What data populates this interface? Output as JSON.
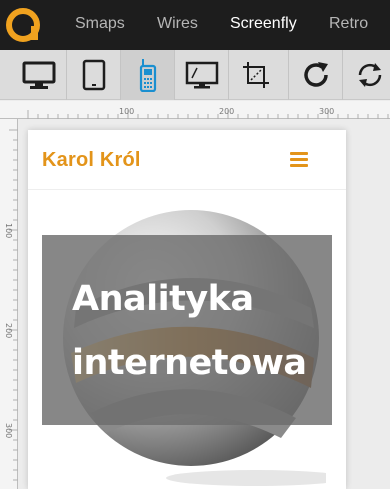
{
  "topbar": {
    "nav": [
      {
        "label": "Smaps"
      },
      {
        "label": "Wires"
      },
      {
        "label": "Screenfly"
      },
      {
        "label": "Retro"
      }
    ],
    "active_index": 2
  },
  "toolbar": {
    "tools": [
      {
        "icon": "desktop-icon"
      },
      {
        "icon": "tablet-icon"
      },
      {
        "icon": "mobile-phone-icon"
      },
      {
        "icon": "television-icon"
      },
      {
        "icon": "custom-size-icon"
      },
      {
        "icon": "refresh-icon"
      },
      {
        "icon": "rotate-icon"
      }
    ],
    "active_index": 2
  },
  "rulers": {
    "top_labels": [
      "100",
      "200",
      "300"
    ],
    "left_labels": [
      "100",
      "200",
      "300"
    ]
  },
  "site": {
    "title": "Karol Król",
    "menu_icon": "hamburger-menu-icon",
    "hero_line1": "Analityka",
    "hero_line2": "internetowa"
  },
  "colors": {
    "accent": "#e3941a",
    "topbar_bg": "#1d1d1d",
    "toolbar_bg": "#dcdcdc",
    "active_tool_icon": "#1a8fd0",
    "overlay": "#6c6c6c"
  }
}
